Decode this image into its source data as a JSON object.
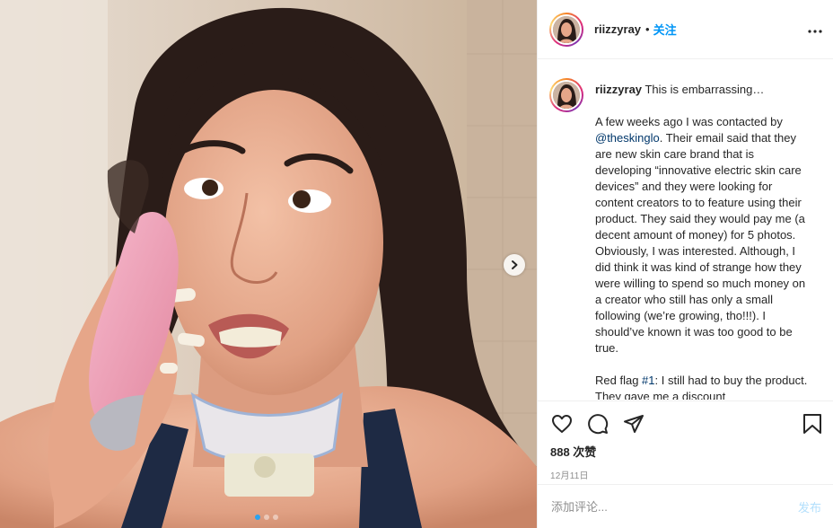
{
  "post": {
    "username": "riizzyray",
    "separator": "•",
    "follow_label": "关注",
    "more_label": "•••"
  },
  "caption": {
    "username": "riizzyray",
    "opening": "This is embarrassing…",
    "para1_pre": "A few weeks ago I was contacted by ",
    "mention": "@theskinglo",
    "para1_post": ". Their email said that they are new skin care brand that is developing “innovative electric skin care devices” and they were looking for content creators to to feature using their product. They said they would pay me (a decent amount of money) for 5 photos. Obviously, I was interested. Although, I did think it was kind of strange how they were willing to spend so much money on a creator who still has only a small following (we’re growing, tho!!!). I should’ve known it was too good to be true.",
    "para2_pre": "Red flag ",
    "hashtag": "#1",
    "para2_post": ": I still had to buy the product. They gave me a discount"
  },
  "actions": {
    "likes": "888 次赞",
    "date": "12月11日"
  },
  "comment": {
    "placeholder": "添加评论...",
    "post_label": "发布"
  },
  "carousel": {
    "slides": 3,
    "active_index": 0
  },
  "icons": [
    "heart-icon",
    "comment-icon",
    "share-icon",
    "bookmark-icon",
    "chevron-right-icon",
    "more-icon"
  ],
  "colors": {
    "accent": "#0095f6",
    "link": "#00376b",
    "muted": "#8e8e8e",
    "post_disabled": "#b2dffc"
  }
}
